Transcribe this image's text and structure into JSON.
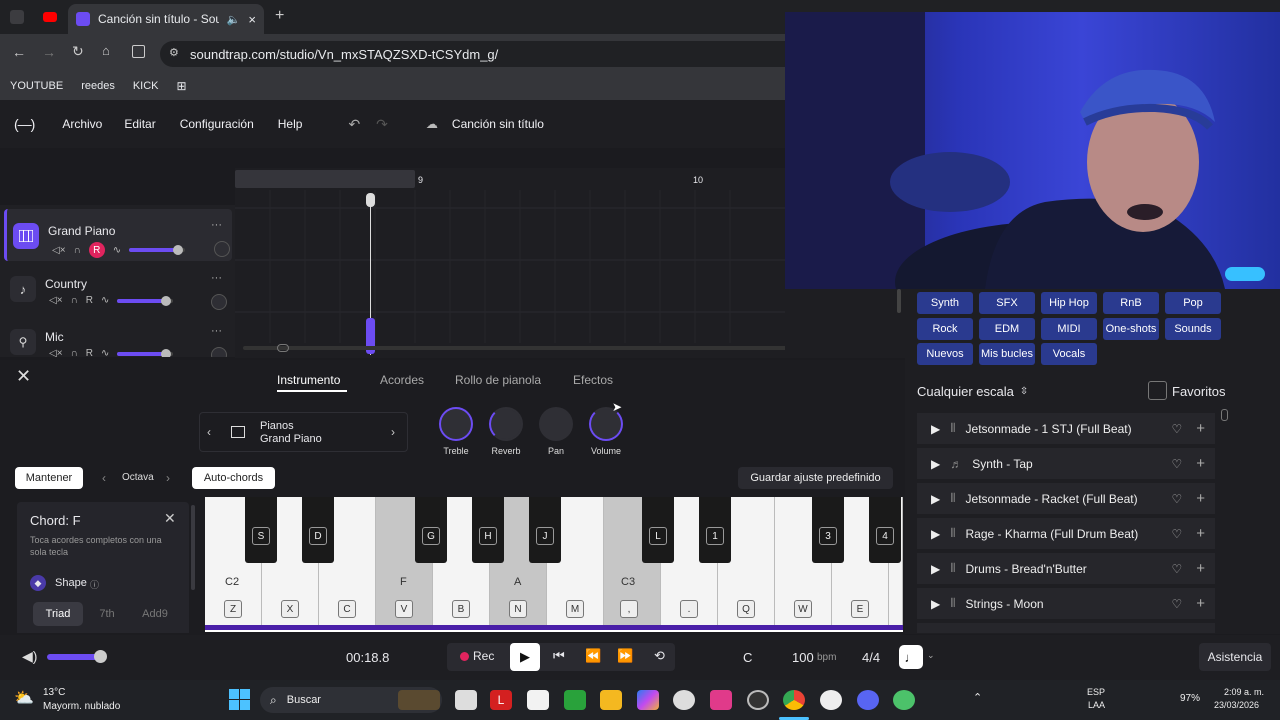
{
  "browser": {
    "tab_title": "Canción sin título - Soundtr",
    "url": "soundtrap.com/studio/Vn_mxSTAQZSXD-tCSYdm_g/",
    "bookmarks": [
      "YOUTUBE",
      "reedes",
      "KICK"
    ]
  },
  "app": {
    "menu": [
      "Archivo",
      "Editar",
      "Configuración",
      "Help"
    ],
    "song_title": "Canción sin título"
  },
  "tracks": [
    {
      "name": "Grand Piano",
      "rec": "R",
      "icon": "piano-icon"
    },
    {
      "name": "Country",
      "rec": "R",
      "icon": "guitar-icon"
    },
    {
      "name": "Mic",
      "rec": "R",
      "icon": "mic-icon"
    }
  ],
  "timeline": {
    "markers": [
      "9",
      "10"
    ]
  },
  "loops": {
    "categories": [
      [
        "Synth",
        "SFX",
        "Hip Hop",
        "RnB",
        "Pop"
      ],
      [
        "Rock",
        "EDM",
        "MIDI",
        "One-shots",
        "Sounds"
      ],
      [
        "Nuevos",
        "Mis bucles",
        "Vocals"
      ]
    ],
    "scale_label": "Cualquier escala",
    "favorites_label": "Favoritos",
    "items": [
      {
        "name": "Jetsonmade - 1 STJ (Full Beat)"
      },
      {
        "name": "Synth - Tap"
      },
      {
        "name": "Jetsonmade - Racket (Full Beat)"
      },
      {
        "name": "Rage - Kharma (Full Drum Beat)"
      },
      {
        "name": "Drums - Bread'n'Butter"
      },
      {
        "name": "Strings - Moon"
      }
    ]
  },
  "instrument": {
    "tabs": [
      "Instrumento",
      "Acordes",
      "Rollo de pianola",
      "Efectos"
    ],
    "category": "Pianos",
    "name": "Grand Piano",
    "knobs": [
      "Treble",
      "Reverb",
      "Pan",
      "Volume"
    ],
    "mantener": "Mantener",
    "octava": "Octava",
    "autochords": "Auto-chords",
    "save_preset": "Guardar ajuste predefinido",
    "chord_title": "Chord: F",
    "chord_desc": "Toca acordes completos con una sola tecla",
    "shape_label": "Shape",
    "shape_options": [
      "Triad",
      "7th",
      "Add9"
    ]
  },
  "keyboard": {
    "white_labels": [
      "Z",
      "X",
      "C",
      "V",
      "B",
      "N",
      "M",
      ",",
      ".",
      "Q",
      "W",
      "E"
    ],
    "black_labels": [
      "S",
      "D",
      "G",
      "H",
      "J",
      "L",
      "1",
      "3",
      "4"
    ],
    "note_names": [
      "C2",
      "F",
      "A",
      "C3"
    ]
  },
  "transport": {
    "time": "00:18.8",
    "rec": "Rec",
    "key": "C",
    "bpm": "100",
    "bpm_unit": "bpm",
    "meter": "4/4",
    "assist": "Asistencia"
  },
  "taskbar": {
    "temp": "13°C",
    "weather": "Mayorm. nublado",
    "search": "Buscar",
    "lang": "ESP",
    "lang2": "LAA",
    "battery": "97%",
    "time": "2:09 a. m.",
    "date": "23/03/2026"
  },
  "colors": {
    "accent": "#6c4cf2",
    "loop_category": "#2a3a8f",
    "rec": "#e0245e"
  }
}
